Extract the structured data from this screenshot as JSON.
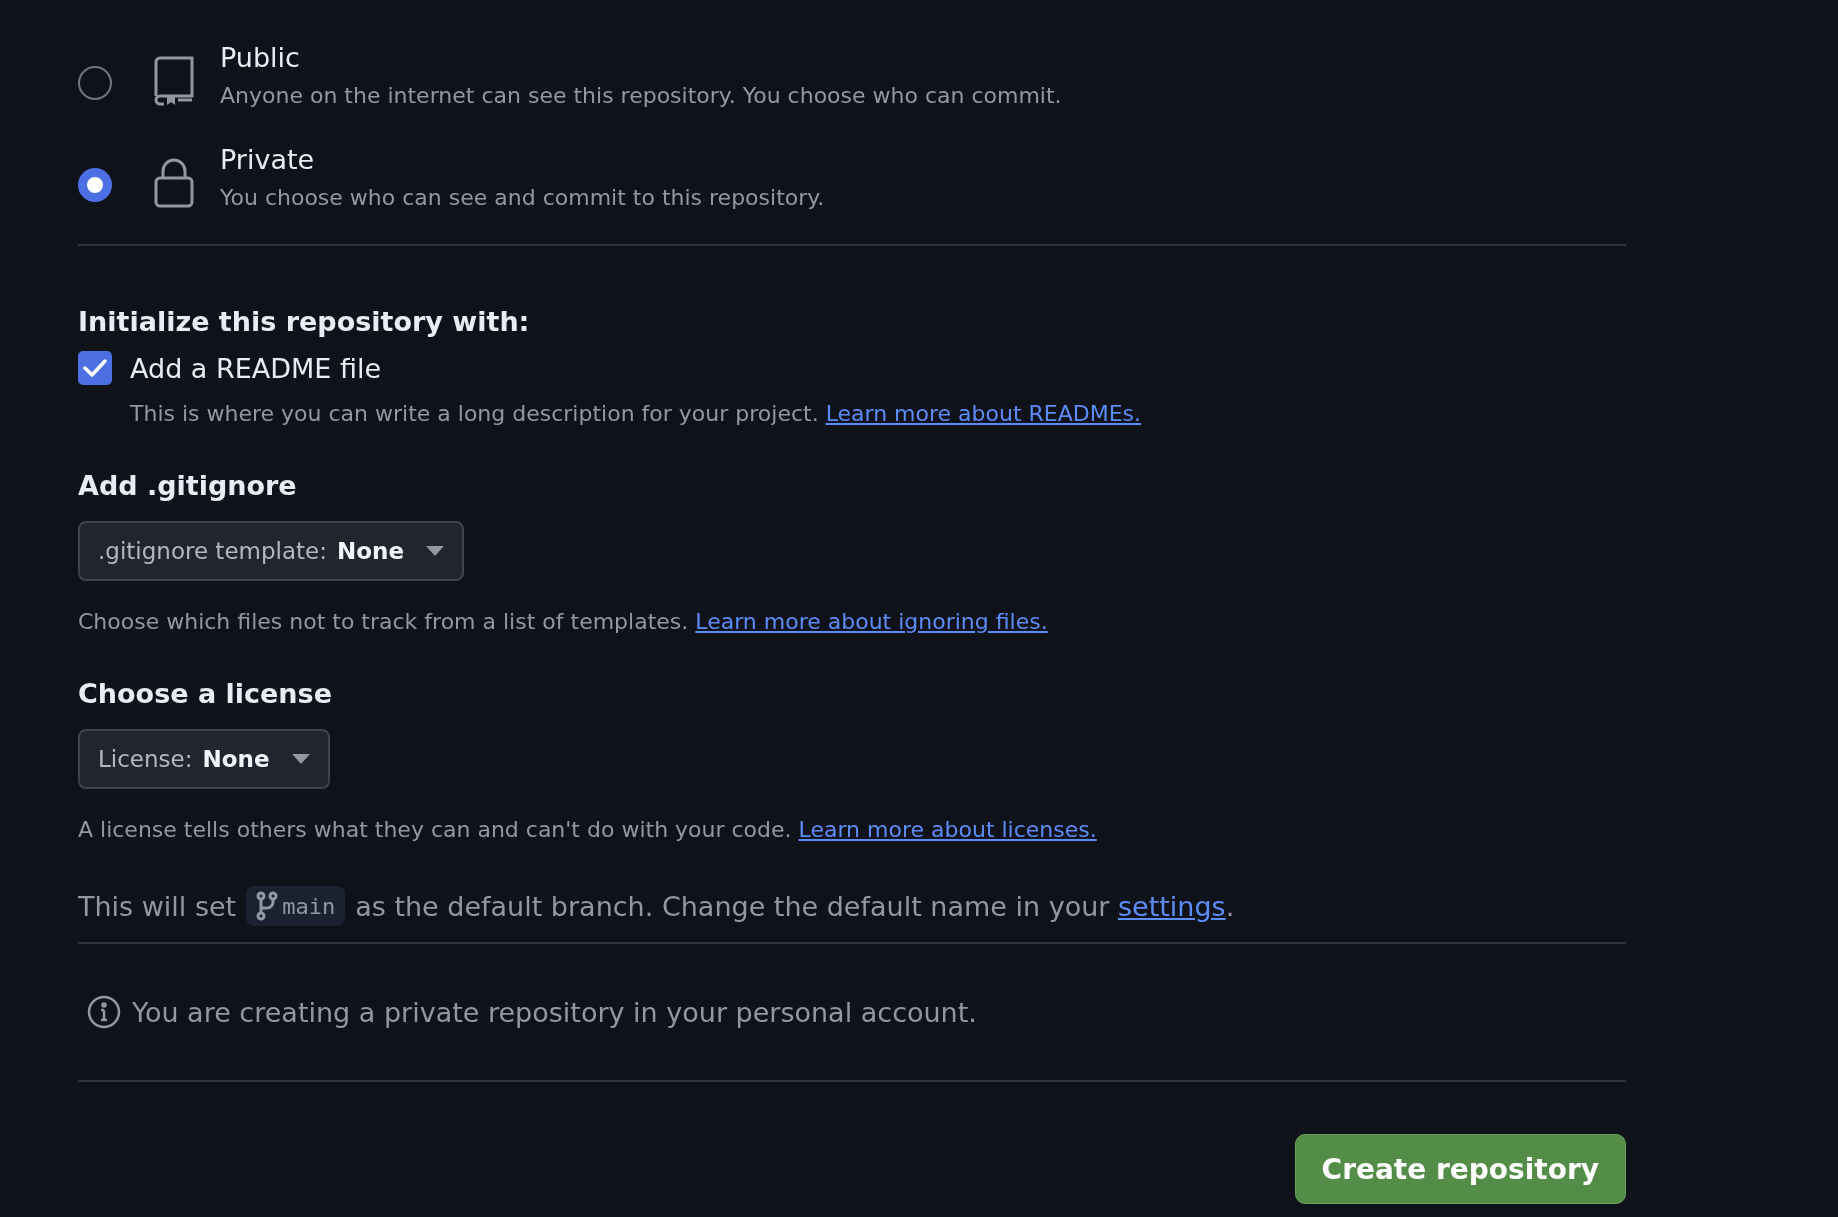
{
  "visibility_options": [
    {
      "kind": "public",
      "title": "Public",
      "description": "Anyone on the internet can see this repository. You choose who can commit.",
      "selected": false
    },
    {
      "kind": "private",
      "title": "Private",
      "description": "You choose who can see and commit to this repository.",
      "selected": true
    }
  ],
  "initialize": {
    "heading": "Initialize this repository with:",
    "readme": {
      "label": "Add a README file",
      "checked": true,
      "description": "This is where you can write a long description for your project.",
      "link": "Learn more about READMEs."
    }
  },
  "gitignore": {
    "heading": "Add .gitignore",
    "dropdown": {
      "label": ".gitignore template:",
      "value": "None"
    },
    "description": "Choose which files not to track from a list of templates.",
    "link": "Learn more about ignoring files."
  },
  "license": {
    "heading": "Choose a license",
    "dropdown": {
      "label": "License:",
      "value": "None"
    },
    "description": "A license tells others what they can and can't do with your code.",
    "link": "Learn more about licenses."
  },
  "default_branch": {
    "prefix": "This will set",
    "branch": "main",
    "suffix": "as the default branch. Change the default name in your",
    "link": "settings",
    "end": "."
  },
  "notice": {
    "text": "You are creating a private repository in your personal account."
  },
  "create_button": {
    "label": "Create repository"
  }
}
